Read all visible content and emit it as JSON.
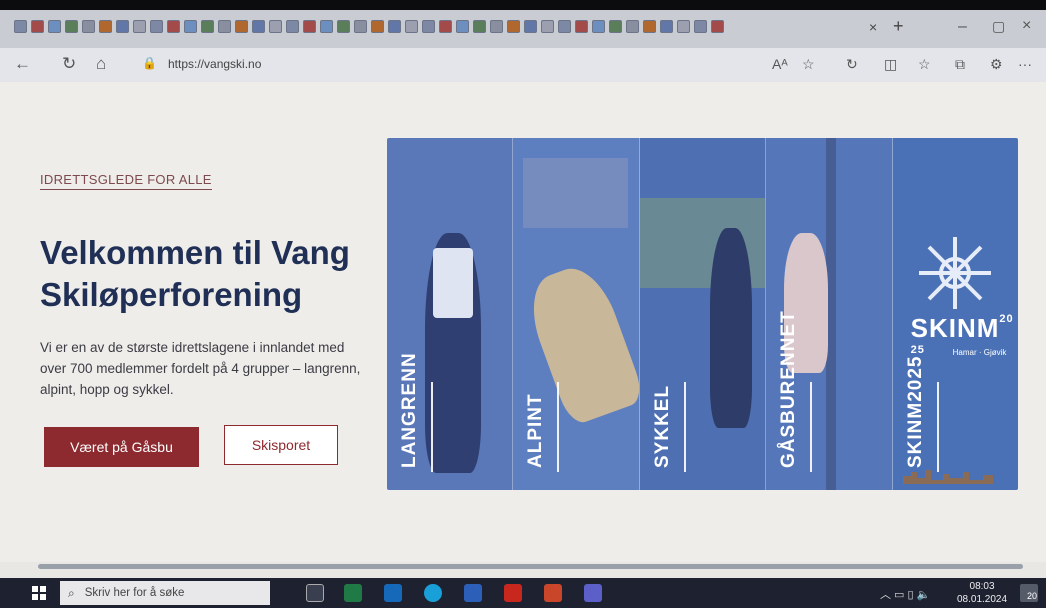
{
  "browser": {
    "url": "https://vangski.no",
    "tab_close": "×",
    "new_tab": "+",
    "minimize": "–",
    "maximize": "▢",
    "close": "×",
    "read_aloud": "Aᴬ",
    "more": "···"
  },
  "page": {
    "eyebrow": "IDRETTSGLEDE FOR ALLE",
    "headline": "Velkommen til Vang Skiløperforening",
    "intro": "Vi er en av de største idrettslagene i innlandet med over 700 medlemmer fordelt på 4 grupper – langrenn, alpint, hopp og sykkel.",
    "primary_button": "Været på Gåsbu",
    "secondary_button": "Skisporet"
  },
  "panels": [
    {
      "label": "LANGRENN",
      "color": "#5a77b8"
    },
    {
      "label": "ALPINT",
      "color": "#5d7fbf"
    },
    {
      "label": "SYKKEL",
      "color": "#4f6fb3"
    },
    {
      "label": "GÅSBURENNET",
      "color": "#5577ba"
    },
    {
      "label": "SKINM2025",
      "color": "#4a70b5"
    }
  ],
  "skinm": {
    "title": "SKINM",
    "year_top": "20",
    "year_bottom": "25",
    "sub": "Hamar · Gjøvik"
  },
  "taskbar": {
    "search_placeholder": "Skriv her for å søke",
    "time": "08:03",
    "date": "08.01.2024",
    "notifications": "20"
  }
}
